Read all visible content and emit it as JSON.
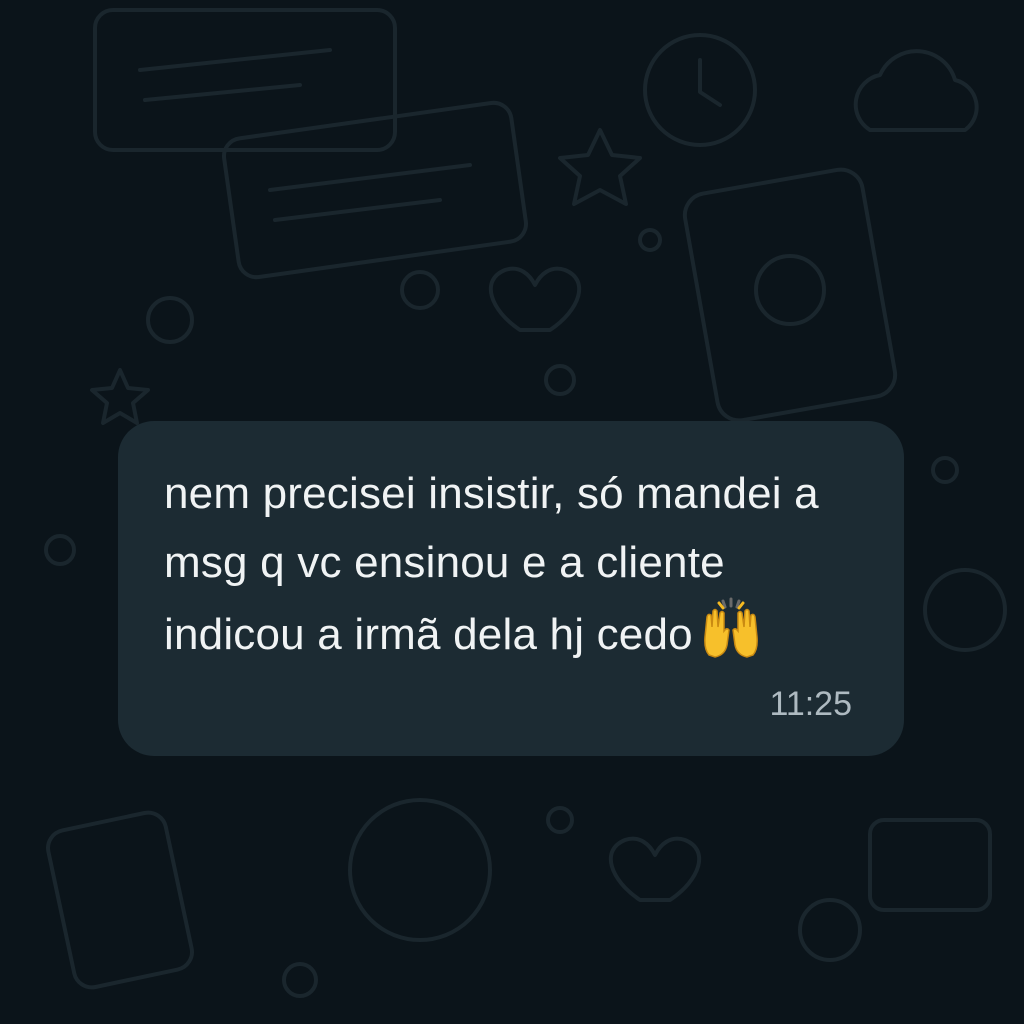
{
  "message": {
    "text": "nem precisei insistir, só mandei a msg q vc ensinou e a cliente indicou a irmã dela hj cedo",
    "emoji": "🙌",
    "emoji_name": "raising-hands-icon",
    "time": "11:25",
    "direction": "incoming"
  },
  "colors": {
    "background": "#0b141a",
    "bubble": "#1c2b33",
    "text": "#f0f3f4",
    "time": "#aebac1",
    "doodle": "#1a262d"
  }
}
